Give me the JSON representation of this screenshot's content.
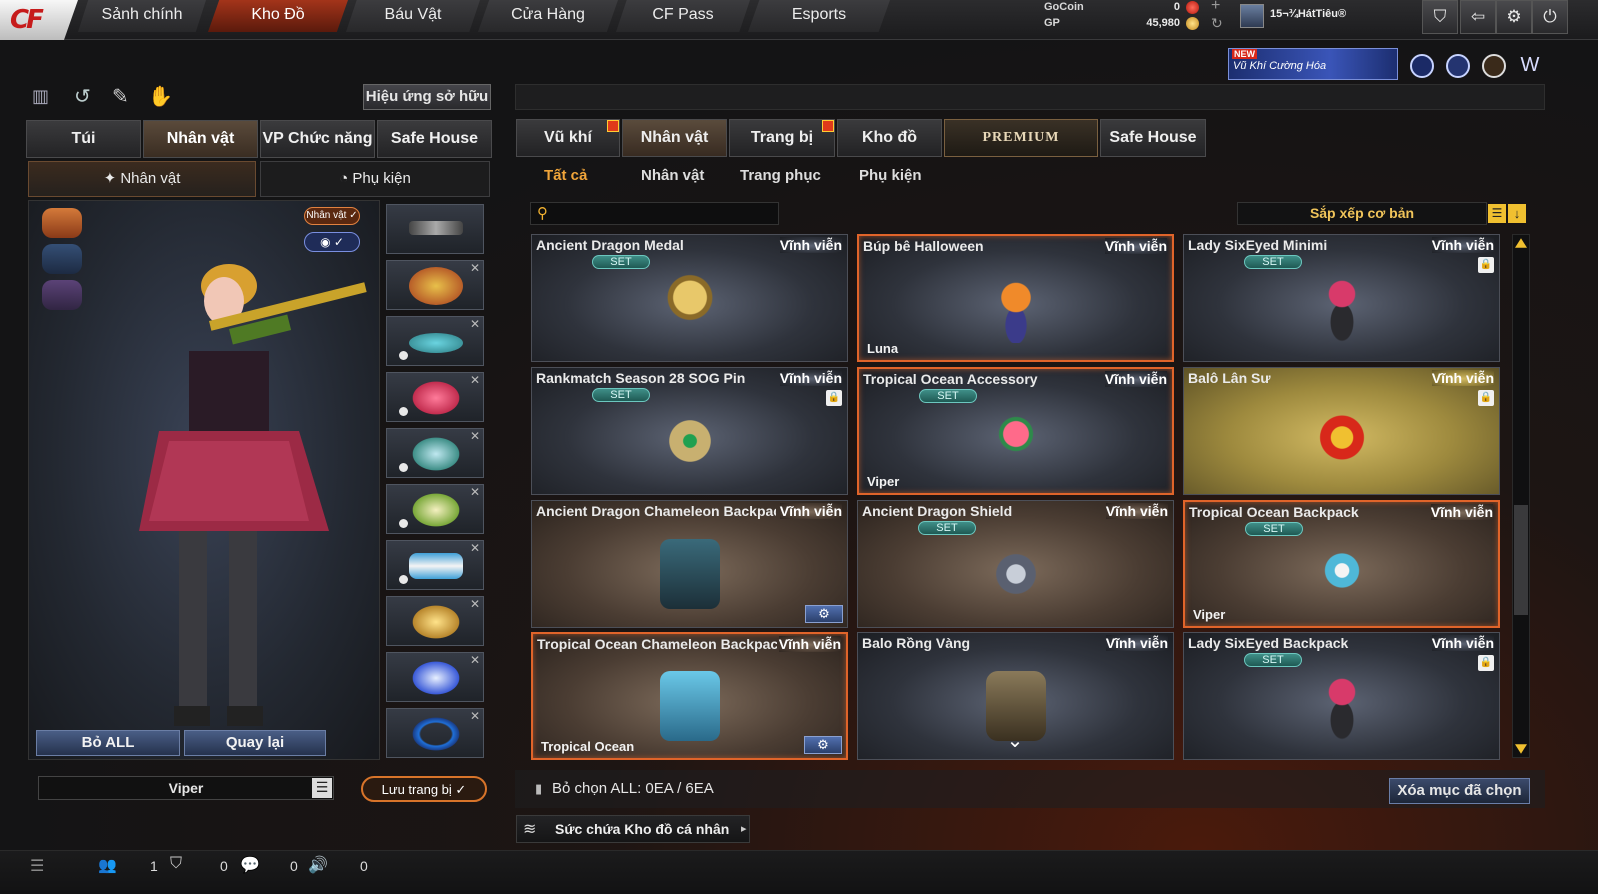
{
  "topnav": {
    "tabs": [
      "Sảnh chính",
      "Kho Đồ",
      "Báu Vật",
      "Cửa Hàng",
      "CF Pass",
      "Esports"
    ],
    "active": "Kho Đồ"
  },
  "currency": {
    "gocoin_label": "GoCoin",
    "gocoin_value": "0",
    "gp_label": "GP",
    "gp_value": "45,980"
  },
  "profile": {
    "name": "15¬¾HátTiêu®"
  },
  "promo": {
    "badge": "NEW",
    "text": "Vũ Khí Cường Hóa"
  },
  "left": {
    "effect_button": "Hiệu ứng sở hữu",
    "tabs": [
      "Túi",
      "Nhân vật",
      "VP Chức năng",
      "Safe House"
    ],
    "active_tab": "Nhân vật",
    "subtabs": [
      "Nhân vật",
      "Phụ kiện"
    ],
    "char_badge": "Nhân vật ✓",
    "clear_all": "Bỏ ALL",
    "back": "Quay lại",
    "character_name": "Viper",
    "save_button": "Lưu trang bị"
  },
  "right": {
    "tabs": [
      "Vũ khí",
      "Nhân vật",
      "Trang bị",
      "Kho đồ",
      "PREMIUM",
      "Safe House"
    ],
    "active_tab": "Nhân vật",
    "subtabs": [
      "Tất cả",
      "Nhân vật",
      "Trang phục",
      "Phụ kiện"
    ],
    "active_subtab": "Tất cả",
    "search_placeholder": "",
    "sort_label": "Sắp xếp cơ bản",
    "items": [
      {
        "name": "Ancient Dragon Medal",
        "duration": "Vĩnh viễn",
        "set": "SET",
        "owner": "",
        "style": "blue",
        "selected": false,
        "lock": false,
        "gear": false,
        "art": "medal"
      },
      {
        "name": "Búp bê Halloween",
        "duration": "Vĩnh viễn",
        "set": "",
        "owner": "Luna",
        "style": "blue",
        "selected": true,
        "lock": false,
        "gear": false,
        "art": "doll"
      },
      {
        "name": "Lady SixEyed Minimi",
        "duration": "Vĩnh viễn",
        "set": "SET",
        "owner": "",
        "style": "blue",
        "selected": false,
        "lock": true,
        "gear": false,
        "art": "minimi"
      },
      {
        "name": "Rankmatch Season 28 SOG Pin",
        "duration": "Vĩnh viễn",
        "set": "SET",
        "owner": "",
        "style": "blue",
        "selected": false,
        "lock": true,
        "gear": false,
        "art": "pin"
      },
      {
        "name": "Tropical Ocean Accessory",
        "duration": "Vĩnh viễn",
        "set": "SET",
        "owner": "Viper",
        "style": "blue",
        "selected": true,
        "lock": false,
        "gear": false,
        "art": "flower"
      },
      {
        "name": "Balô Lân Sư",
        "duration": "Vĩnh viễn",
        "set": "",
        "owner": "",
        "style": "gold",
        "selected": false,
        "lock": true,
        "gear": false,
        "art": "lion"
      },
      {
        "name": "Ancient Dragon Chameleon Backpack",
        "duration": "Vĩnh viễn",
        "set": "",
        "owner": "",
        "style": "brown",
        "selected": false,
        "lock": false,
        "gear": true,
        "art": "backpack"
      },
      {
        "name": "Ancient Dragon Shield",
        "duration": "Vĩnh viễn",
        "set": "SET",
        "owner": "",
        "style": "brown",
        "selected": false,
        "lock": false,
        "gear": false,
        "art": "shield"
      },
      {
        "name": "Tropical Ocean Backpack",
        "duration": "Vĩnh viễn",
        "set": "SET",
        "owner": "Viper",
        "style": "brown",
        "selected": true,
        "lock": false,
        "gear": false,
        "art": "turtle"
      },
      {
        "name": "Tropical Ocean Chameleon Backpack",
        "duration": "Vĩnh viễn",
        "set": "",
        "owner": "Tropical Ocean",
        "style": "brown",
        "selected": true,
        "lock": false,
        "gear": true,
        "art": "backpack2"
      },
      {
        "name": "Balo Rồng Vàng",
        "duration": "Vĩnh viễn",
        "set": "",
        "owner": "",
        "style": "blue",
        "selected": false,
        "lock": false,
        "gear": false,
        "art": "goldpack"
      },
      {
        "name": "Lady SixEyed Backpack",
        "duration": "Vĩnh viễn",
        "set": "SET",
        "owner": "",
        "style": "blue",
        "selected": false,
        "lock": true,
        "gear": false,
        "art": "minimi"
      }
    ],
    "unselect_info": "Bỏ chọn ALL: 0EA / 6EA",
    "delete_button": "Xóa mục đã chọn",
    "capacity": "Sức chứa Kho đồ cá nhân"
  },
  "statusbar": {
    "values": [
      "1",
      "0",
      "0",
      "0"
    ]
  },
  "colors": {
    "accent": "#e0642a",
    "active_tab": "#a3341a",
    "set_badge": "#3f8f88"
  }
}
